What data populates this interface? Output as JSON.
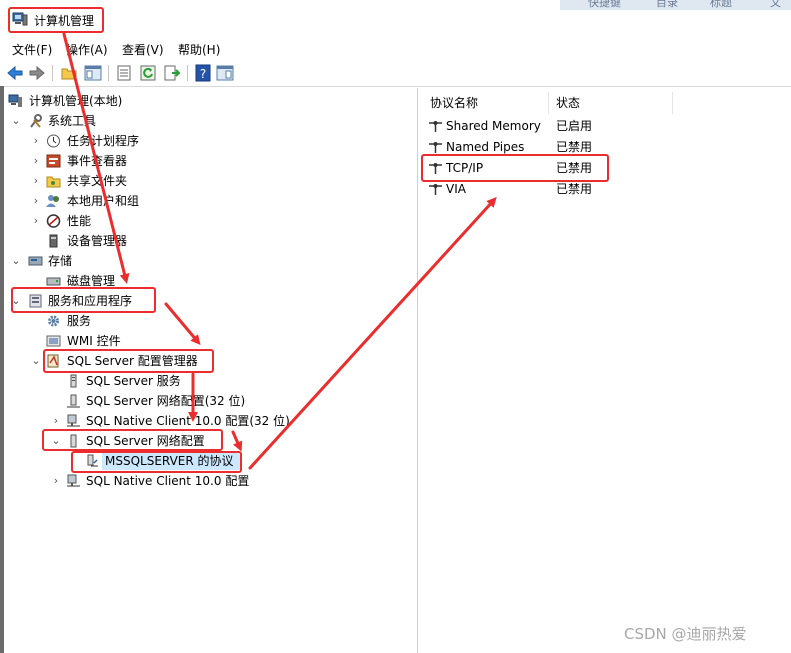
{
  "window": {
    "title": "计算机管理"
  },
  "top_tabs": [
    "快捷键",
    "目录",
    "标题",
    "文字"
  ],
  "menu": [
    "文件(F)",
    "操作(A)",
    "查看(V)",
    "帮助(H)"
  ],
  "tree": {
    "root": "计算机管理(本地)",
    "system_tools": "系统工具",
    "task_scheduler": "任务计划程序",
    "event_viewer": "事件查看器",
    "shared_folders": "共享文件夹",
    "local_users": "本地用户和组",
    "performance": "性能",
    "device_manager": "设备管理器",
    "storage": "存储",
    "disk_management": "磁盘管理",
    "services_apps": "服务和应用程序",
    "services": "服务",
    "wmi": "WMI 控件",
    "sql_config": "SQL Server 配置管理器",
    "sql_services": "SQL Server 服务",
    "sql_net32": "SQL Server 网络配置(32 位)",
    "native_client32": "SQL Native Client 10.0 配置(32 位)",
    "sql_net": "SQL Server 网络配置",
    "mssql_protocols": "MSSQLSERVER 的协议",
    "native_client": "SQL Native Client 10.0 配置"
  },
  "list": {
    "columns": [
      "协议名称",
      "状态"
    ],
    "rows": [
      {
        "name": "Shared Memory",
        "status": "已启用"
      },
      {
        "name": "Named Pipes",
        "status": "已禁用"
      },
      {
        "name": "TCP/IP",
        "status": "已禁用"
      },
      {
        "name": "VIA",
        "status": "已禁用"
      }
    ]
  },
  "watermark": "CSDN @迪丽热爱",
  "colors": {
    "annotation": "#ec2d2d",
    "selection": "#cce8ff"
  }
}
